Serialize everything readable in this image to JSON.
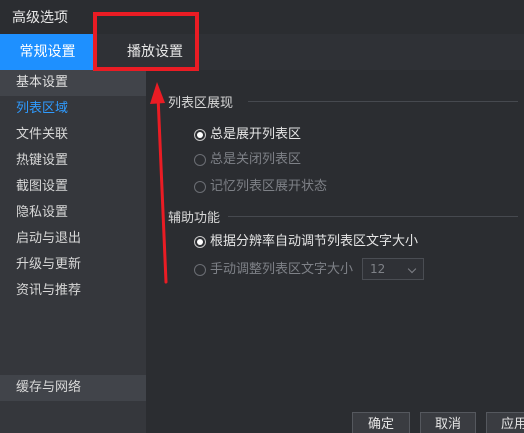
{
  "window": {
    "title": "高级选项"
  },
  "tabs": [
    {
      "label": "常规设置",
      "active": true
    },
    {
      "label": "播放设置",
      "active": false
    }
  ],
  "sidebar": {
    "items": [
      {
        "label": "基本设置"
      },
      {
        "label": "列表区域"
      },
      {
        "label": "文件关联"
      },
      {
        "label": "热键设置"
      },
      {
        "label": "截图设置"
      },
      {
        "label": "隐私设置"
      },
      {
        "label": "启动与退出"
      },
      {
        "label": "升级与更新"
      },
      {
        "label": "资讯与推荐"
      }
    ],
    "bottom_item": "缓存与网络"
  },
  "content": {
    "list_group": {
      "title": "列表区展现",
      "options": [
        "总是展开列表区",
        "总是关闭列表区",
        "记忆列表区展开状态"
      ],
      "selected_index": 0
    },
    "aux_group": {
      "title": "辅助功能",
      "options": [
        "根据分辨率自动调节列表区文字大小",
        "手动调整列表区文字大小"
      ],
      "selected_index": 0,
      "font_size_value": "12"
    }
  },
  "footer": {
    "ok_label": "确定",
    "cancel_label": "取消",
    "apply_label": "应用"
  },
  "colors": {
    "accent": "#1e90ff",
    "annotation": "#ea1c24",
    "background": "#2b2d31"
  }
}
